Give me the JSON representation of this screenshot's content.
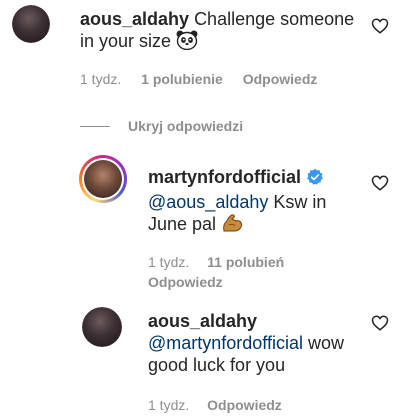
{
  "comment1": {
    "username": "aous_aldahy",
    "text": "Challenge someone in your size",
    "emoji_icon": "panda-face-icon",
    "time": "1 tydz.",
    "likes": "1 polubienie",
    "reply": "Odpowiedz"
  },
  "hide_replies": "Ukryj odpowiedzi",
  "reply1": {
    "username": "martynfordofficial",
    "verified_icon": "verified-badge-icon",
    "mention": "@aous_aldahy",
    "text": "Ksw in June pal",
    "emoji_icon": "flexed-biceps-icon",
    "time": "1 tydz.",
    "likes": "11 polubień",
    "reply": "Odpowiedz"
  },
  "reply2": {
    "username": "aous_aldahy",
    "mention": "@martynfordofficial",
    "text": "wow good luck for you",
    "time": "1 tydz.",
    "reply": "Odpowiedz"
  },
  "colors": {
    "verified": "#3897f0",
    "mention": "#00376b",
    "meta": "#8e8e8e"
  }
}
